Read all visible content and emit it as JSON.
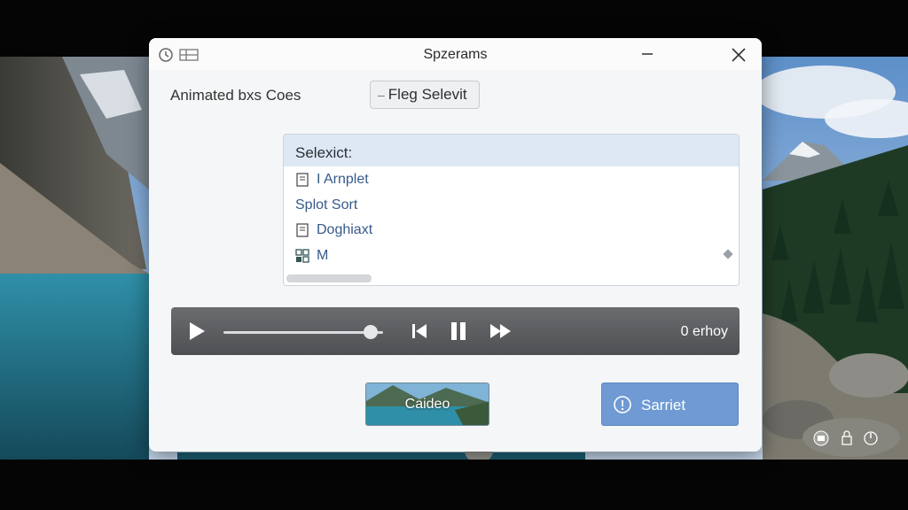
{
  "window": {
    "title": "Spzerams",
    "minimize_glyph": "—",
    "close_glyph": "×"
  },
  "toolbar": {
    "heading": "Animated bxs Coes",
    "flag_button_label": "Fleg Selevit",
    "flag_button_prefix": "–"
  },
  "list": {
    "header": "Selexict:",
    "items": [
      {
        "label": "I Arnplet",
        "icon": "document-icon"
      },
      {
        "label": "Splot Sort",
        "icon": ""
      },
      {
        "label": "Doghiaxt",
        "icon": "document-icon"
      },
      {
        "label": "M",
        "icon": "grid-icon"
      }
    ]
  },
  "player": {
    "status": "0 erhoy",
    "progress": 0.92,
    "controls": [
      "play-icon",
      "skip-back-icon",
      "pause-icon",
      "fast-forward-icon"
    ]
  },
  "buttons": {
    "thumb_label": "Caideo",
    "primary_label": "Sarriet",
    "primary_icon": "info-icon"
  },
  "tray_icons": [
    "folder-icon",
    "lock-icon",
    "power-icon"
  ],
  "colors": {
    "accent": "#6f9ad3",
    "list_header_bg": "#dde8f4",
    "list_text": "#375a8a",
    "player_bg": "#5d5f62"
  }
}
